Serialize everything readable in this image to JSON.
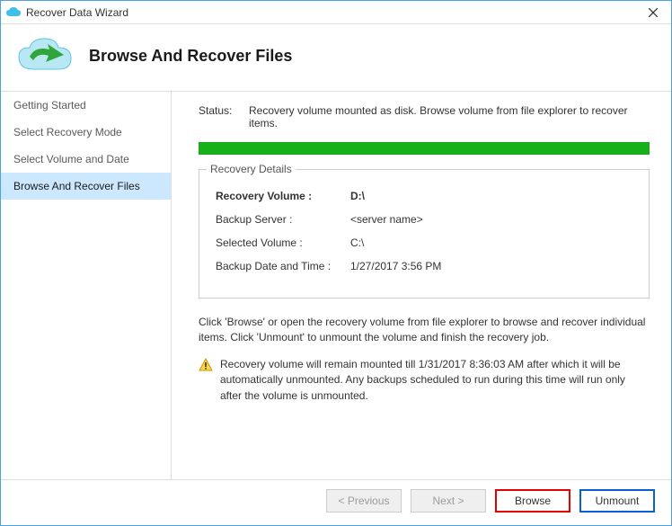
{
  "window": {
    "title": "Recover Data Wizard"
  },
  "header": {
    "heading": "Browse And Recover Files"
  },
  "sidebar": {
    "items": [
      {
        "label": "Getting Started",
        "active": false
      },
      {
        "label": "Select Recovery Mode",
        "active": false
      },
      {
        "label": "Select Volume and Date",
        "active": false
      },
      {
        "label": "Browse And Recover Files",
        "active": true
      }
    ]
  },
  "status": {
    "label": "Status:",
    "text": "Recovery volume mounted as disk. Browse volume from file explorer to recover items."
  },
  "details": {
    "legend": "Recovery Details",
    "recovery_volume_label": "Recovery Volume :",
    "recovery_volume_value": "D:\\",
    "backup_server_label": "Backup Server :",
    "backup_server_value": "<server name>",
    "selected_volume_label": "Selected Volume :",
    "selected_volume_value": "C:\\",
    "backup_datetime_label": "Backup Date and Time :",
    "backup_datetime_value": "1/27/2017 3:56 PM"
  },
  "info": "Click 'Browse' or open the recovery volume from file explorer to browse and recover individual items. Click 'Unmount' to unmount the volume and finish the recovery job.",
  "warning": "Recovery volume will remain mounted till 1/31/2017 8:36:03 AM after which it will be automatically unmounted. Any backups scheduled to run during this time will run only after the volume is unmounted.",
  "buttons": {
    "previous": "< Previous",
    "next": "Next >",
    "browse": "Browse",
    "unmount": "Unmount"
  }
}
